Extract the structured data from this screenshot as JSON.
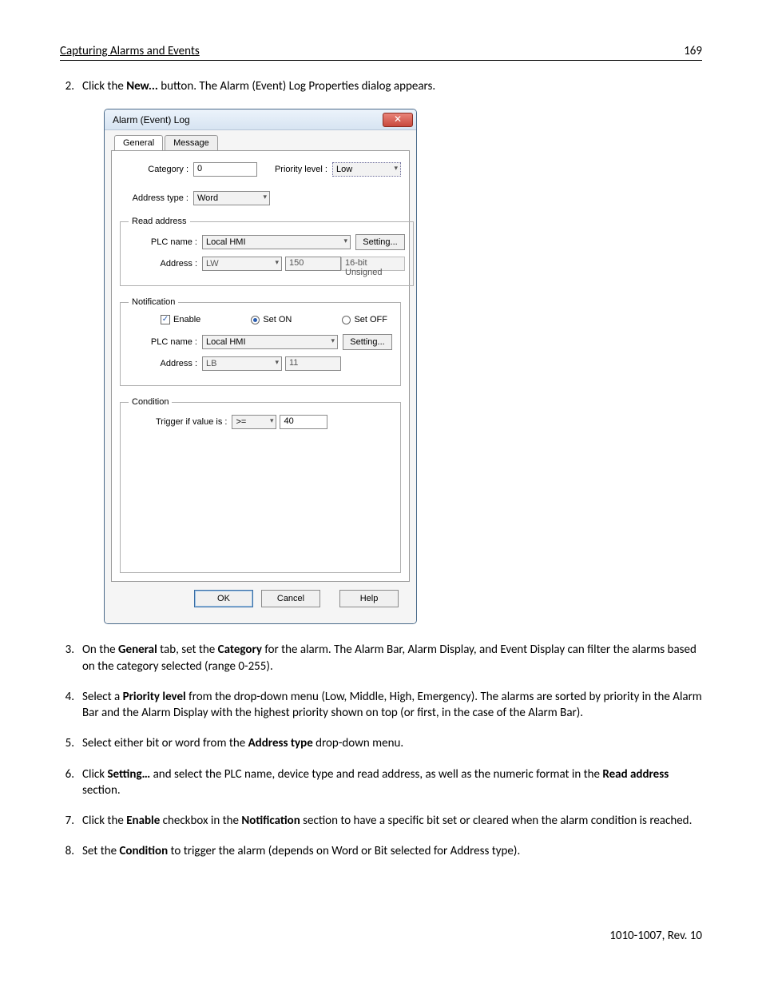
{
  "header": {
    "title": "Capturing Alarms and Events",
    "page": "169"
  },
  "footer": {
    "rev": "1010-1007, Rev. 10"
  },
  "steps": {
    "s2": {
      "num": "2.",
      "pre": "Click the ",
      "b1": "New...",
      "post": " button. The Alarm (Event) Log Properties dialog appears."
    },
    "s3": {
      "num": "3.",
      "t1": "On the ",
      "b1": "General",
      "t2": " tab, set the ",
      "b2": "Category",
      "t3": " for the alarm. The Alarm Bar, Alarm Display, and Event Display can filter the alarms based on the category selected (range 0-255)."
    },
    "s4": {
      "num": "4.",
      "t1": "Select a ",
      "b1": "Priority level",
      "t2": " from the drop-down menu (Low, Middle, High, Emergency). The alarms are sorted by priority in the Alarm Bar and the Alarm Display with the highest priority shown on top (or first, in the case of the Alarm Bar)."
    },
    "s5": {
      "num": "5.",
      "t1": "Select either bit or word from the ",
      "b1": "Address type",
      "t2": " drop-down menu."
    },
    "s6": {
      "num": "6.",
      "t1": "Click ",
      "b1": "Setting…",
      "t2": " and select the PLC name, device type and read address, as well as the numeric format in the ",
      "b2": "Read address",
      "t3": " section."
    },
    "s7": {
      "num": "7.",
      "t1": "Click the ",
      "b1": "Enable",
      "t2": " checkbox in the ",
      "b2": "Notification",
      "t3": " section to have a specific bit set or cleared when the alarm condition is reached."
    },
    "s8": {
      "num": "8.",
      "t1": "Set the ",
      "b1": "Condition",
      "t2": " to trigger the alarm (depends on Word or Bit selected for Address type)."
    }
  },
  "dialog": {
    "title": "Alarm (Event) Log",
    "close": "✕",
    "tabs": {
      "general": "General",
      "message": "Message"
    },
    "category_label": "Category :",
    "category_value": "0",
    "priority_label": "Priority level :",
    "priority_value": "Low",
    "addrtype_label": "Address type :",
    "addrtype_value": "Word",
    "grp_read": "Read address",
    "plc_label": "PLC name :",
    "plc_value": "Local HMI",
    "setting_btn": "Setting...",
    "addr_label": "Address :",
    "read_addr_dev": "LW",
    "read_addr_num": "150",
    "read_addr_fmt": "16-bit Unsigned",
    "grp_notif": "Notification",
    "enable": "Enable",
    "set_on": "Set ON",
    "set_off": "Set OFF",
    "notif_addr_dev": "LB",
    "notif_addr_num": "11",
    "grp_cond": "Condition",
    "trigger_label": "Trigger if value is :",
    "trigger_op": ">=",
    "trigger_val": "40",
    "ok": "OK",
    "cancel": "Cancel",
    "help": "Help"
  }
}
